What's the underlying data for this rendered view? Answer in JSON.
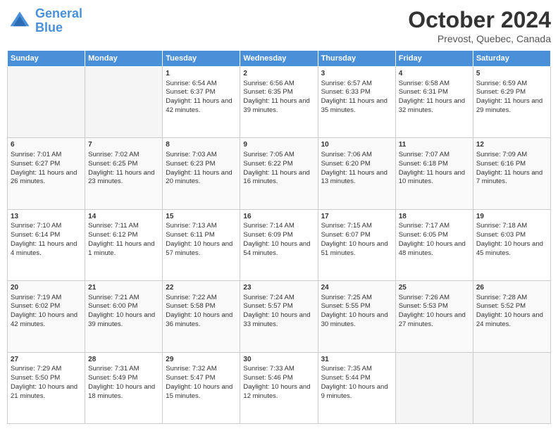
{
  "logo": {
    "line1": "General",
    "line2": "Blue"
  },
  "title": "October 2024",
  "subtitle": "Prevost, Quebec, Canada",
  "days_of_week": [
    "Sunday",
    "Monday",
    "Tuesday",
    "Wednesday",
    "Thursday",
    "Friday",
    "Saturday"
  ],
  "weeks": [
    [
      {
        "day": "",
        "sunrise": "",
        "sunset": "",
        "daylight": "",
        "empty": true
      },
      {
        "day": "",
        "sunrise": "",
        "sunset": "",
        "daylight": "",
        "empty": true
      },
      {
        "day": "1",
        "sunrise": "Sunrise: 6:54 AM",
        "sunset": "Sunset: 6:37 PM",
        "daylight": "Daylight: 11 hours and 42 minutes."
      },
      {
        "day": "2",
        "sunrise": "Sunrise: 6:56 AM",
        "sunset": "Sunset: 6:35 PM",
        "daylight": "Daylight: 11 hours and 39 minutes."
      },
      {
        "day": "3",
        "sunrise": "Sunrise: 6:57 AM",
        "sunset": "Sunset: 6:33 PM",
        "daylight": "Daylight: 11 hours and 35 minutes."
      },
      {
        "day": "4",
        "sunrise": "Sunrise: 6:58 AM",
        "sunset": "Sunset: 6:31 PM",
        "daylight": "Daylight: 11 hours and 32 minutes."
      },
      {
        "day": "5",
        "sunrise": "Sunrise: 6:59 AM",
        "sunset": "Sunset: 6:29 PM",
        "daylight": "Daylight: 11 hours and 29 minutes."
      }
    ],
    [
      {
        "day": "6",
        "sunrise": "Sunrise: 7:01 AM",
        "sunset": "Sunset: 6:27 PM",
        "daylight": "Daylight: 11 hours and 26 minutes."
      },
      {
        "day": "7",
        "sunrise": "Sunrise: 7:02 AM",
        "sunset": "Sunset: 6:25 PM",
        "daylight": "Daylight: 11 hours and 23 minutes."
      },
      {
        "day": "8",
        "sunrise": "Sunrise: 7:03 AM",
        "sunset": "Sunset: 6:23 PM",
        "daylight": "Daylight: 11 hours and 20 minutes."
      },
      {
        "day": "9",
        "sunrise": "Sunrise: 7:05 AM",
        "sunset": "Sunset: 6:22 PM",
        "daylight": "Daylight: 11 hours and 16 minutes."
      },
      {
        "day": "10",
        "sunrise": "Sunrise: 7:06 AM",
        "sunset": "Sunset: 6:20 PM",
        "daylight": "Daylight: 11 hours and 13 minutes."
      },
      {
        "day": "11",
        "sunrise": "Sunrise: 7:07 AM",
        "sunset": "Sunset: 6:18 PM",
        "daylight": "Daylight: 11 hours and 10 minutes."
      },
      {
        "day": "12",
        "sunrise": "Sunrise: 7:09 AM",
        "sunset": "Sunset: 6:16 PM",
        "daylight": "Daylight: 11 hours and 7 minutes."
      }
    ],
    [
      {
        "day": "13",
        "sunrise": "Sunrise: 7:10 AM",
        "sunset": "Sunset: 6:14 PM",
        "daylight": "Daylight: 11 hours and 4 minutes."
      },
      {
        "day": "14",
        "sunrise": "Sunrise: 7:11 AM",
        "sunset": "Sunset: 6:12 PM",
        "daylight": "Daylight: 11 hours and 1 minute."
      },
      {
        "day": "15",
        "sunrise": "Sunrise: 7:13 AM",
        "sunset": "Sunset: 6:11 PM",
        "daylight": "Daylight: 10 hours and 57 minutes."
      },
      {
        "day": "16",
        "sunrise": "Sunrise: 7:14 AM",
        "sunset": "Sunset: 6:09 PM",
        "daylight": "Daylight: 10 hours and 54 minutes."
      },
      {
        "day": "17",
        "sunrise": "Sunrise: 7:15 AM",
        "sunset": "Sunset: 6:07 PM",
        "daylight": "Daylight: 10 hours and 51 minutes."
      },
      {
        "day": "18",
        "sunrise": "Sunrise: 7:17 AM",
        "sunset": "Sunset: 6:05 PM",
        "daylight": "Daylight: 10 hours and 48 minutes."
      },
      {
        "day": "19",
        "sunrise": "Sunrise: 7:18 AM",
        "sunset": "Sunset: 6:03 PM",
        "daylight": "Daylight: 10 hours and 45 minutes."
      }
    ],
    [
      {
        "day": "20",
        "sunrise": "Sunrise: 7:19 AM",
        "sunset": "Sunset: 6:02 PM",
        "daylight": "Daylight: 10 hours and 42 minutes."
      },
      {
        "day": "21",
        "sunrise": "Sunrise: 7:21 AM",
        "sunset": "Sunset: 6:00 PM",
        "daylight": "Daylight: 10 hours and 39 minutes."
      },
      {
        "day": "22",
        "sunrise": "Sunrise: 7:22 AM",
        "sunset": "Sunset: 5:58 PM",
        "daylight": "Daylight: 10 hours and 36 minutes."
      },
      {
        "day": "23",
        "sunrise": "Sunrise: 7:24 AM",
        "sunset": "Sunset: 5:57 PM",
        "daylight": "Daylight: 10 hours and 33 minutes."
      },
      {
        "day": "24",
        "sunrise": "Sunrise: 7:25 AM",
        "sunset": "Sunset: 5:55 PM",
        "daylight": "Daylight: 10 hours and 30 minutes."
      },
      {
        "day": "25",
        "sunrise": "Sunrise: 7:26 AM",
        "sunset": "Sunset: 5:53 PM",
        "daylight": "Daylight: 10 hours and 27 minutes."
      },
      {
        "day": "26",
        "sunrise": "Sunrise: 7:28 AM",
        "sunset": "Sunset: 5:52 PM",
        "daylight": "Daylight: 10 hours and 24 minutes."
      }
    ],
    [
      {
        "day": "27",
        "sunrise": "Sunrise: 7:29 AM",
        "sunset": "Sunset: 5:50 PM",
        "daylight": "Daylight: 10 hours and 21 minutes."
      },
      {
        "day": "28",
        "sunrise": "Sunrise: 7:31 AM",
        "sunset": "Sunset: 5:49 PM",
        "daylight": "Daylight: 10 hours and 18 minutes."
      },
      {
        "day": "29",
        "sunrise": "Sunrise: 7:32 AM",
        "sunset": "Sunset: 5:47 PM",
        "daylight": "Daylight: 10 hours and 15 minutes."
      },
      {
        "day": "30",
        "sunrise": "Sunrise: 7:33 AM",
        "sunset": "Sunset: 5:46 PM",
        "daylight": "Daylight: 10 hours and 12 minutes."
      },
      {
        "day": "31",
        "sunrise": "Sunrise: 7:35 AM",
        "sunset": "Sunset: 5:44 PM",
        "daylight": "Daylight: 10 hours and 9 minutes."
      },
      {
        "day": "",
        "sunrise": "",
        "sunset": "",
        "daylight": "",
        "empty": true
      },
      {
        "day": "",
        "sunrise": "",
        "sunset": "",
        "daylight": "",
        "empty": true
      }
    ]
  ]
}
